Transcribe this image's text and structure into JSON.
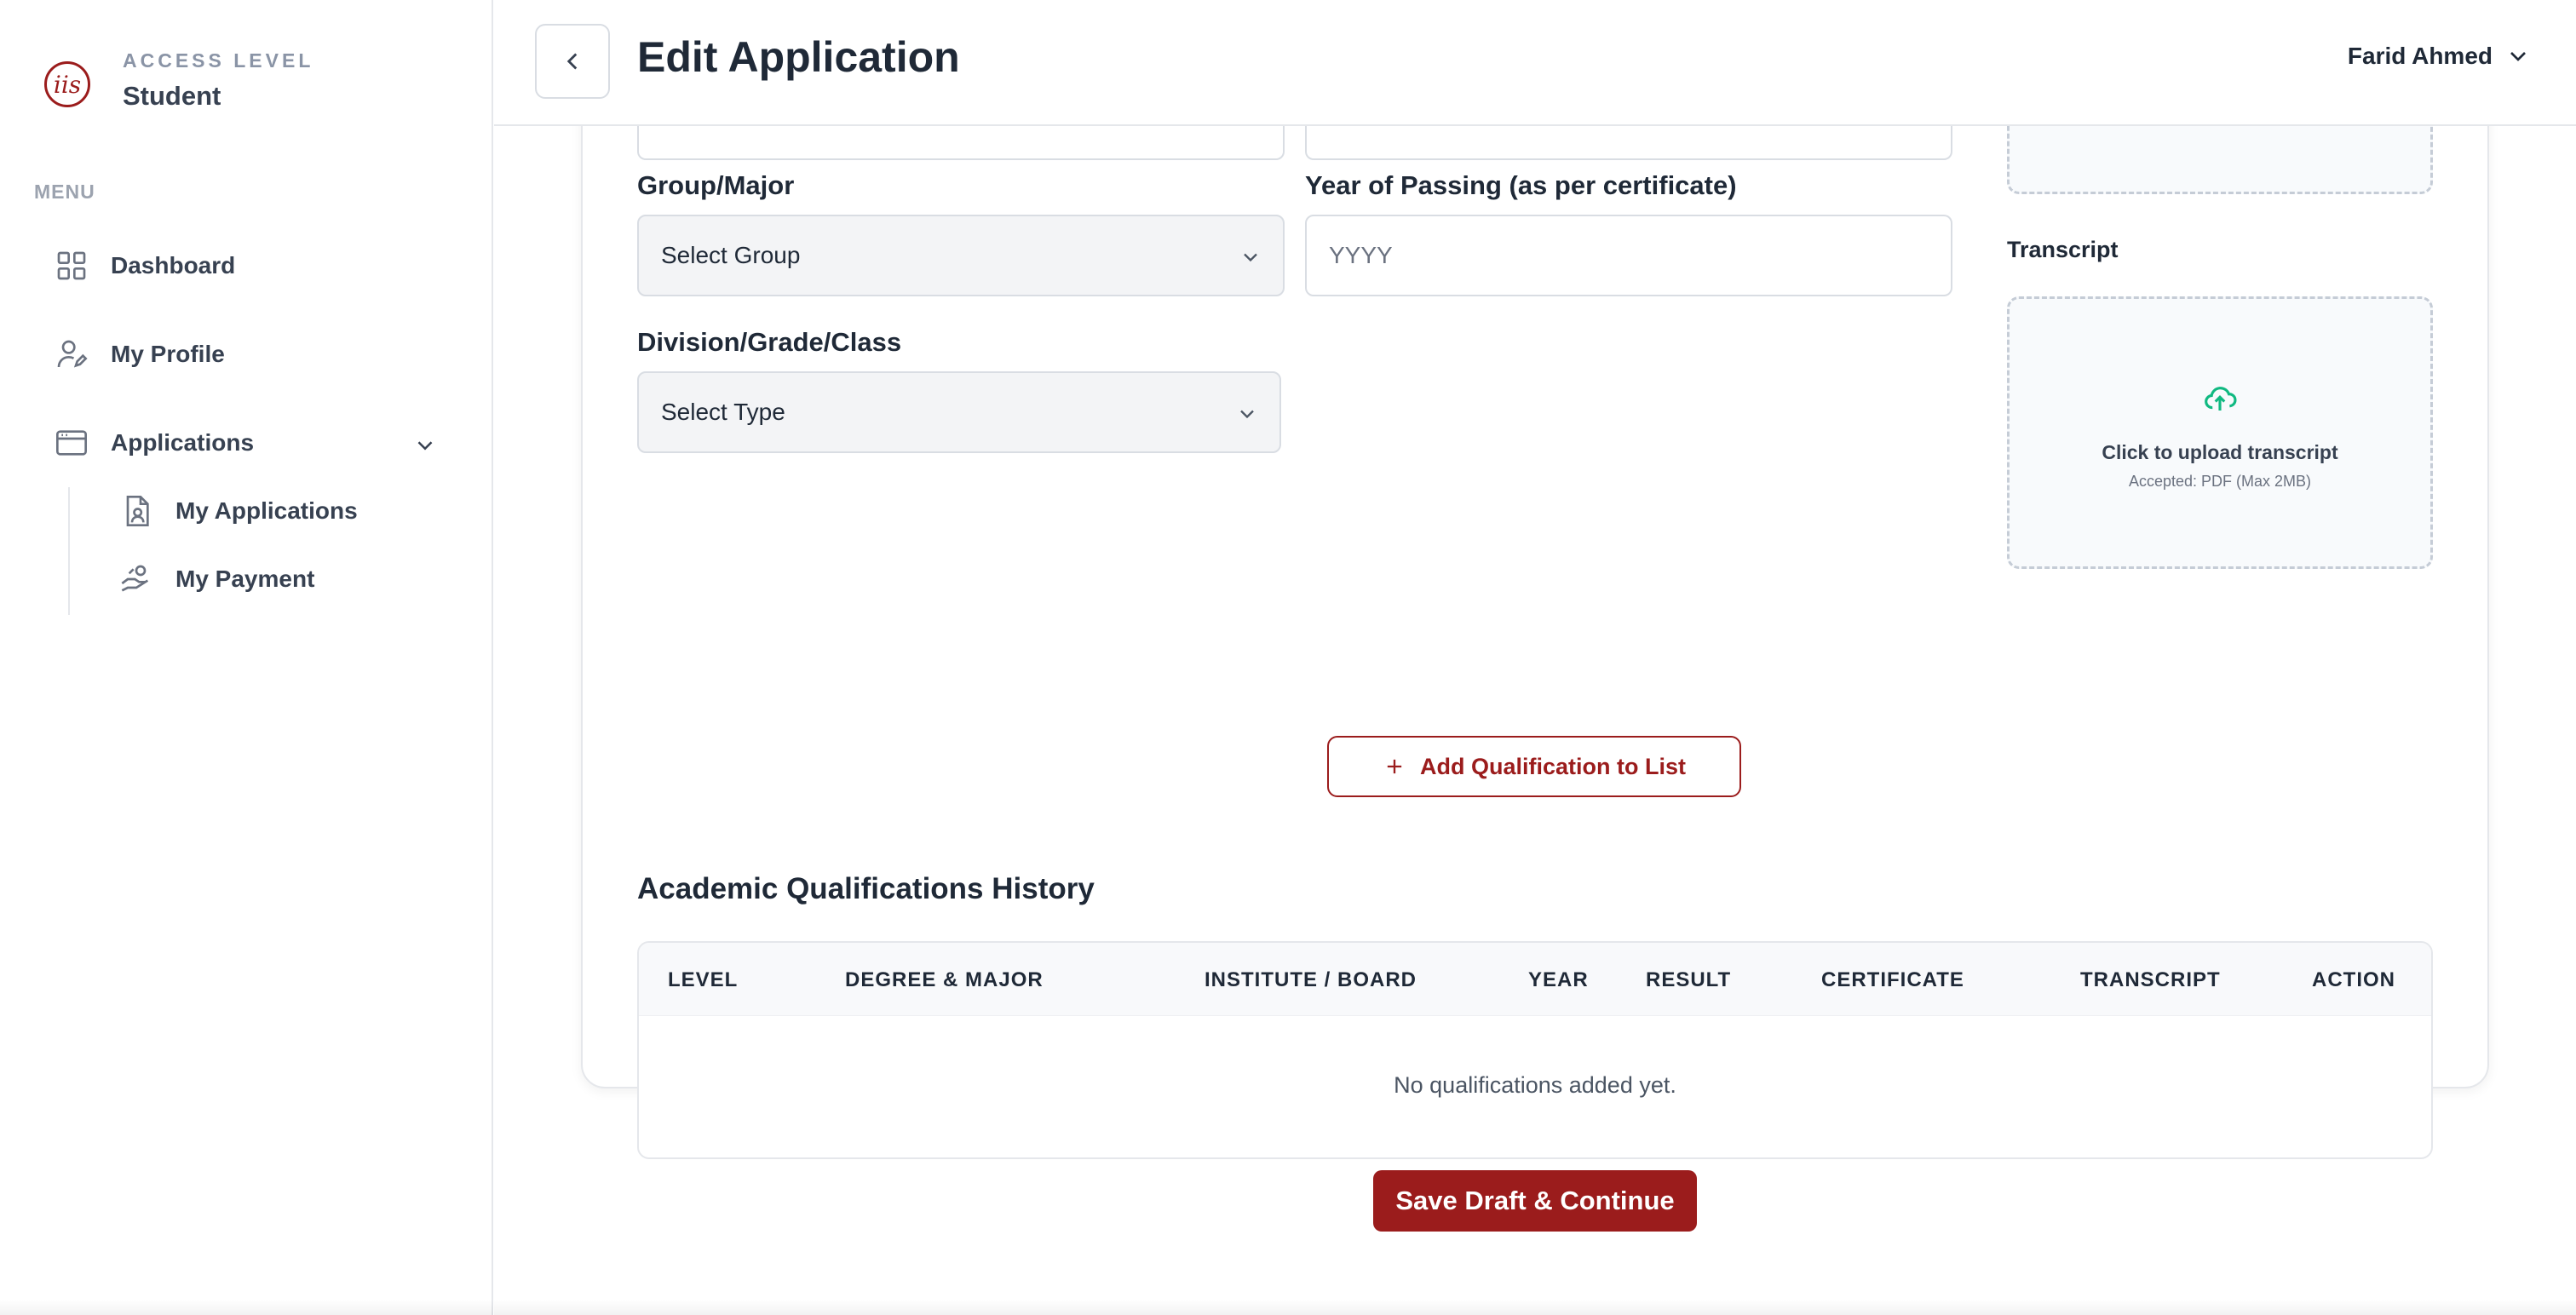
{
  "brand": {
    "logo_text": "iis",
    "access_label": "ACCESS LEVEL",
    "access_value": "Student"
  },
  "sidebar": {
    "menu_label": "MENU",
    "items": [
      {
        "label": "Dashboard",
        "icon": "grid-icon"
      },
      {
        "label": "My Profile",
        "icon": "user-edit-icon"
      },
      {
        "label": "Applications",
        "icon": "browser-window-icon"
      }
    ],
    "sub_items": [
      {
        "label": "My Applications",
        "icon": "document-user-icon"
      },
      {
        "label": "My Payment",
        "icon": "hand-payment-icon"
      }
    ]
  },
  "header": {
    "title": "Edit Application",
    "user_name": "Farid Ahmed"
  },
  "form": {
    "group_label": "Group/Major",
    "group_value": "Select Group",
    "year_label": "Year of Passing (as per certificate)",
    "year_placeholder": "YYYY",
    "division_label": "Division/Grade/Class",
    "division_value": "Select Type"
  },
  "uploads": {
    "transcript_label": "Transcript",
    "transcript_title": "Click to upload transcript",
    "transcript_sub": "Accepted: PDF (Max 2MB)"
  },
  "actions": {
    "add_qualification": "Add Qualification to List",
    "save": "Save Draft & Continue"
  },
  "history": {
    "title": "Academic Qualifications History",
    "columns": [
      "LEVEL",
      "DEGREE & MAJOR",
      "INSTITUTE / BOARD",
      "YEAR",
      "RESULT",
      "CERTIFICATE",
      "TRANSCRIPT",
      "ACTION"
    ],
    "empty_message": "No qualifications added yet."
  },
  "colors": {
    "brand": "#9b1c1c",
    "upload_icon": "#10b981",
    "border": "#e5e7eb"
  }
}
